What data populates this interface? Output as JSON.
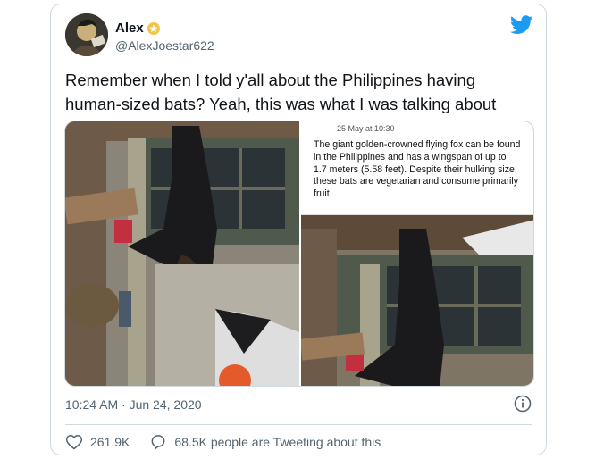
{
  "tweet": {
    "display_name": "Alex",
    "handle": "@AlexJoestar622",
    "text": "Remember when I told y'all about the Philippines having human-sized bats? Yeah, this was what I was talking about",
    "timestamp": "10:24 AM · Jun 24, 2020",
    "likes": "261.9K",
    "conversation": "68.5K people are Tweeting about this"
  },
  "media": {
    "right_photo": {
      "caption_date": "25 May at 10:30 ·",
      "caption_text": "The giant golden-crowned flying fox can be found in the Philippines and has a wingspan of up to 1.7 meters (5.58 feet). Despite their hulking size, these bats are vegetarian and consume primarily fruit."
    }
  },
  "icons": {
    "logo": "twitter-bird-icon",
    "badge": "star-badge-icon",
    "info": "info-icon",
    "like": "heart-icon",
    "reply": "speech-bubble-icon"
  },
  "colors": {
    "twitter_blue": "#1d9bf0",
    "text_primary": "#0f1419",
    "text_secondary": "#536471",
    "border": "#cfd9de"
  }
}
